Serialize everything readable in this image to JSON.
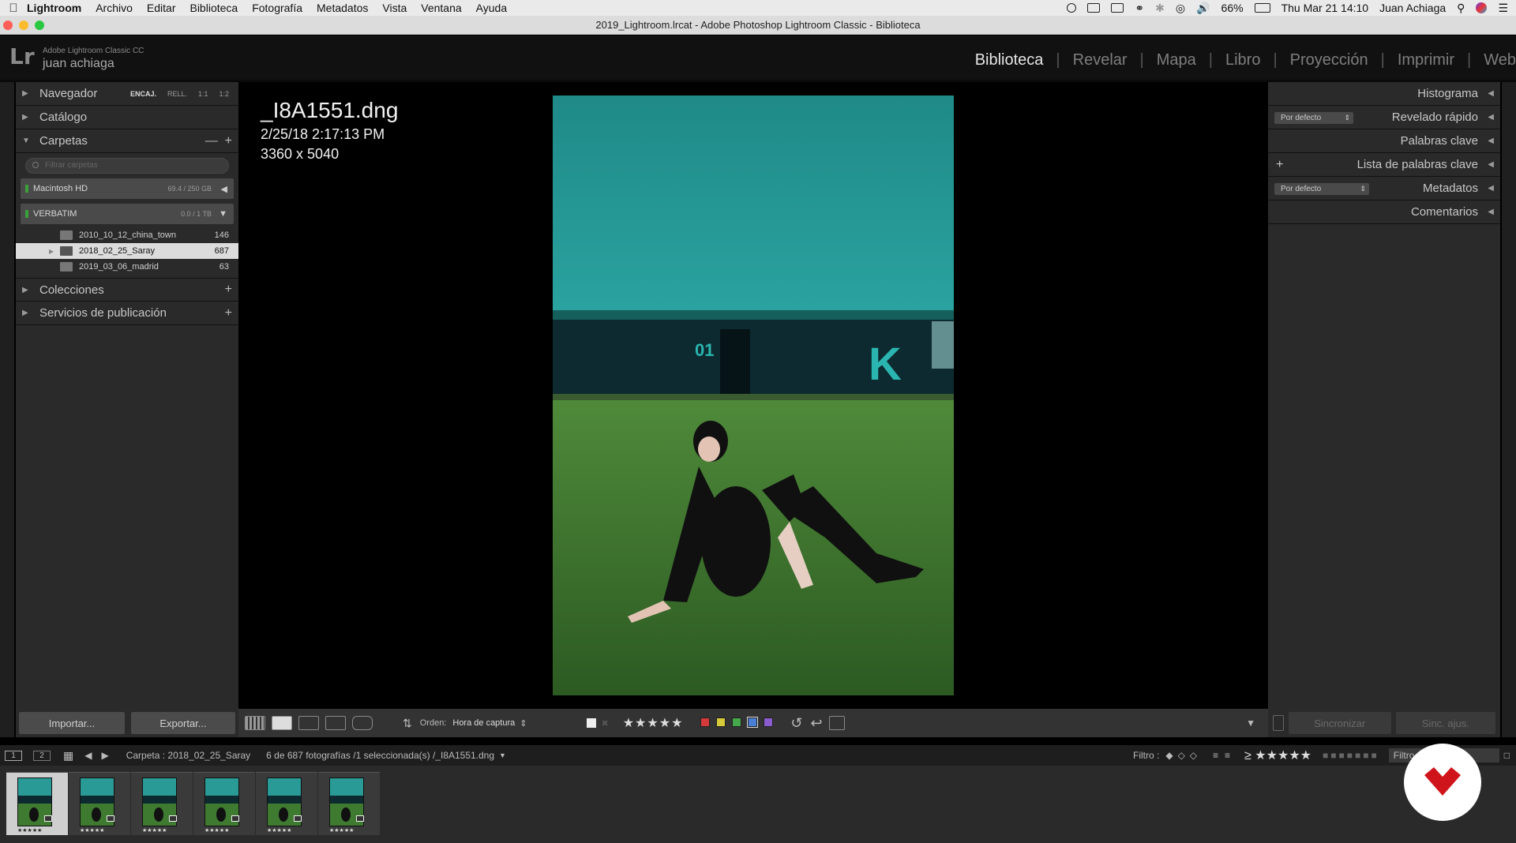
{
  "menubar": {
    "app": "Lightroom",
    "items": [
      "Archivo",
      "Editar",
      "Biblioteca",
      "Fotografía",
      "Metadatos",
      "Vista",
      "Ventana",
      "Ayuda"
    ],
    "battery": "66%",
    "clock": "Thu Mar 21  14:10",
    "user": "Juan Achiaga"
  },
  "window": {
    "title": "2019_Lightroom.lrcat - Adobe Photoshop Lightroom Classic - Biblioteca"
  },
  "identity": {
    "logo": "Lr",
    "product": "Adobe Lightroom Classic CC",
    "user": "juan achiaga"
  },
  "modules": [
    "Biblioteca",
    "Revelar",
    "Mapa",
    "Libro",
    "Proyección",
    "Imprimir",
    "Web"
  ],
  "left_panel": {
    "navigator": {
      "label": "Navegador",
      "zoom": [
        "ENCAJ.",
        "RELL.",
        "1:1",
        "1:2"
      ]
    },
    "catalog": {
      "label": "Catálogo"
    },
    "folders": {
      "label": "Carpetas",
      "filter_placeholder": "Filtrar carpetas",
      "volumes": [
        {
          "name": "Macintosh HD",
          "size": "69.4 / 250 GB"
        },
        {
          "name": "VERBATIM",
          "size": "0.0 / 1 TB"
        }
      ],
      "items": [
        {
          "name": "2010_10_12_china_town",
          "count": "146"
        },
        {
          "name": "2018_02_25_Saray",
          "count": "687"
        },
        {
          "name": "2019_03_06_madrid",
          "count": "63"
        }
      ]
    },
    "collections": {
      "label": "Colecciones"
    },
    "publish": {
      "label": "Servicios de publicación"
    },
    "import_label": "Importar...",
    "export_label": "Exportar..."
  },
  "right_panel": {
    "histogram": "Histograma",
    "quick_develop": "Revelado rápido",
    "quick_develop_preset": "Por defecto",
    "keywording": "Palabras clave",
    "keyword_list": "Lista de palabras clave",
    "metadata": "Metadatos",
    "metadata_preset": "Por defecto",
    "comments": "Comentarios",
    "sync_label": "Sincronizar",
    "sync_settings_label": "Sinc. ajus."
  },
  "photo": {
    "filename": "_I8A1551.dng",
    "datetime": "2/25/18 2:17:13 PM",
    "dimensions": "3360 x 5040"
  },
  "toolbar": {
    "sort_label": "Orden:",
    "sort_value": "Hora de captura",
    "colors": [
      "#d43a3a",
      "#d6c93a",
      "#45a84a",
      "#4a7fd6",
      "#8b5bd0"
    ]
  },
  "filmbar": {
    "screen1": "1",
    "screen2": "2",
    "source": "Carpeta : 2018_02_25_Saray",
    "count": "6 de 687 fotografías /1 seleccionada(s) /_I8A1551.dng",
    "filter_label": "Filtro :",
    "filter_value": "Filtro"
  },
  "filmstrip": {
    "thumbs": 6,
    "stars": "★★★★★"
  }
}
